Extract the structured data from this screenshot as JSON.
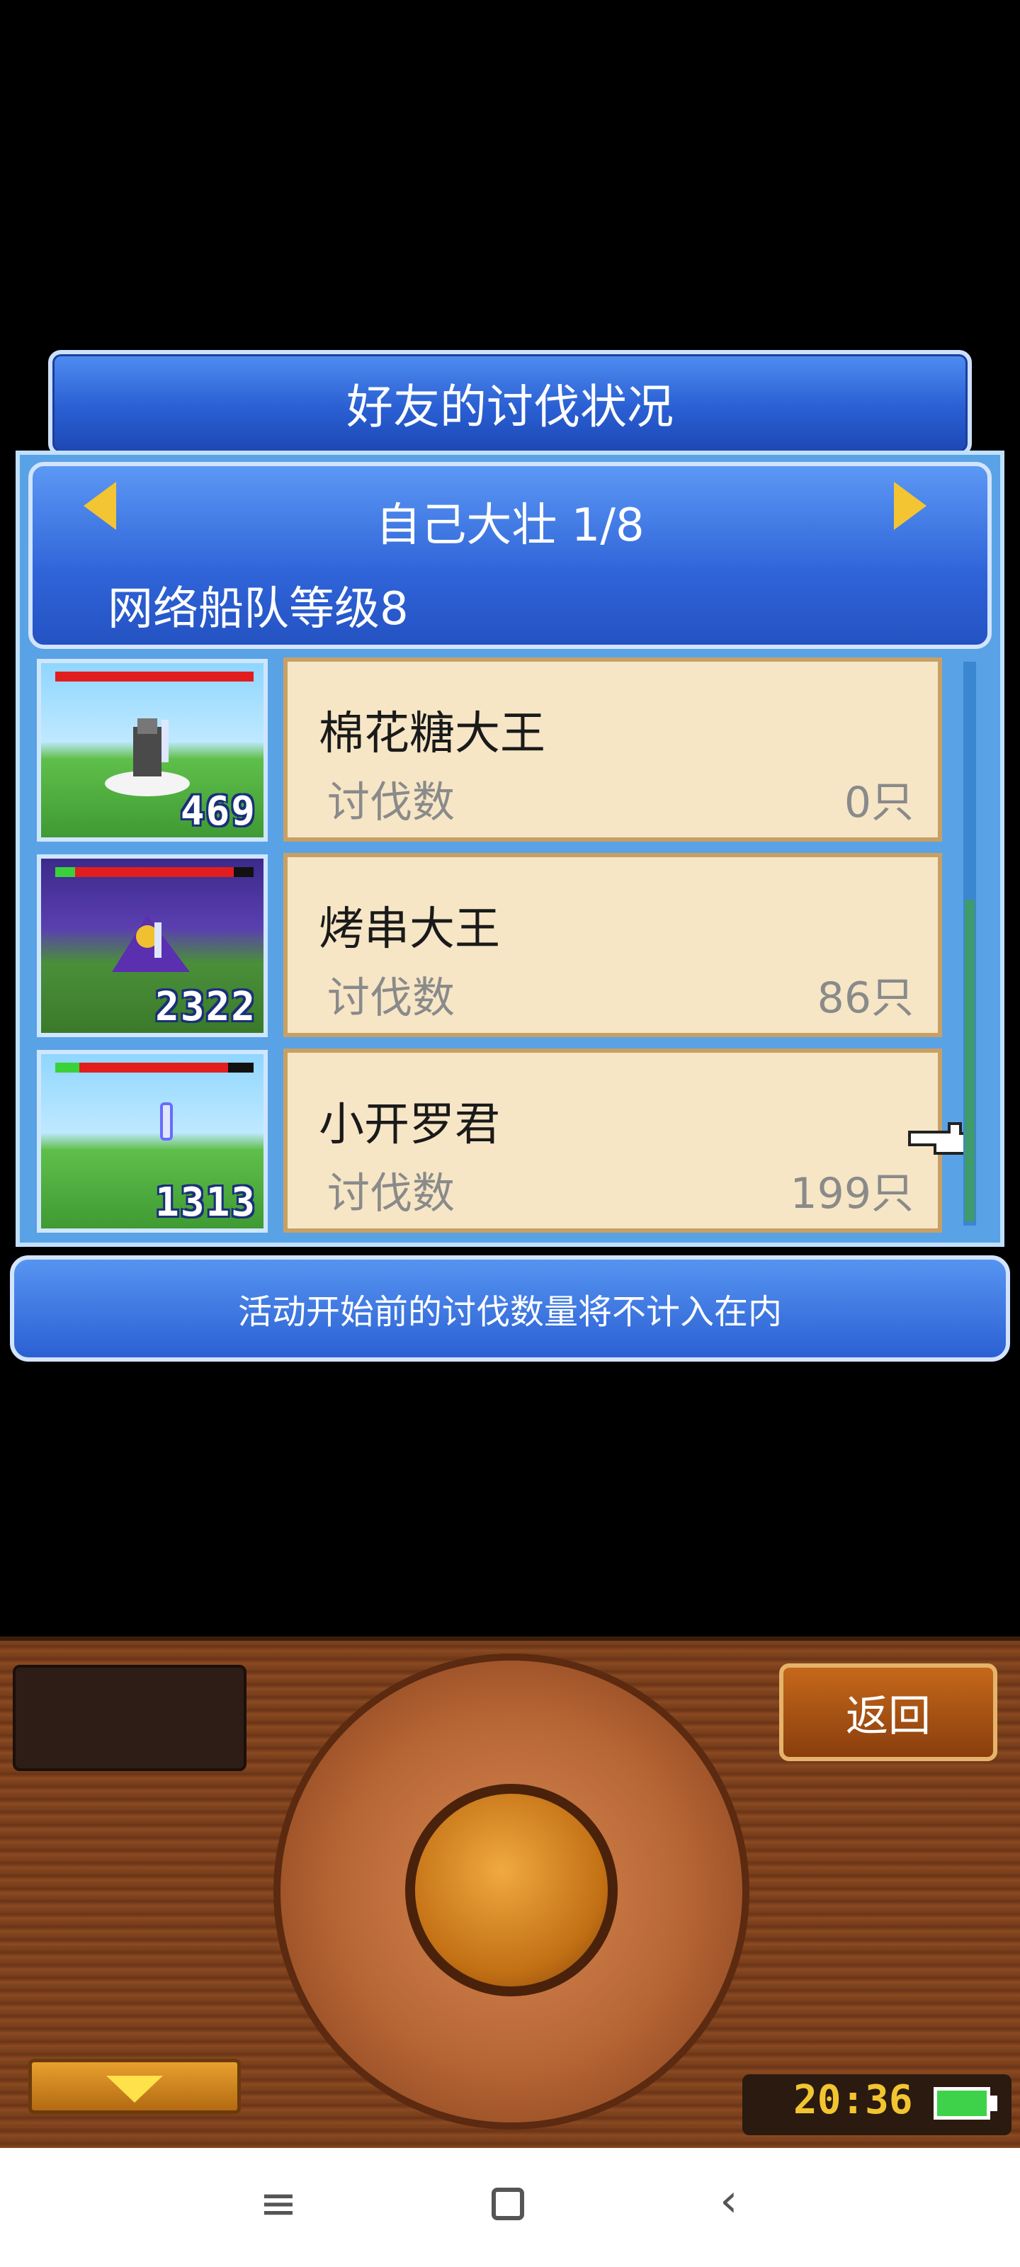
{
  "title": "好友的讨伐状况",
  "header": {
    "friend_name": "自己大壮 1/8",
    "fleet_level": "网络船队等级8"
  },
  "friends": [
    {
      "name": "棉花糖大王",
      "label": "讨伐数",
      "count": "0只",
      "level": "469",
      "hp_fraction": 1.0
    },
    {
      "name": "烤串大王",
      "label": "讨伐数",
      "count": "86只",
      "level": "2322",
      "hp_fraction": 0.9
    },
    {
      "name": "小开罗君",
      "label": "讨伐数",
      "count": "199只",
      "level": "1313",
      "hp_fraction": 0.75
    }
  ],
  "note": "活动开始前的讨伐数量将不计入在内",
  "controller": {
    "back_label": "返回",
    "clock": "20:36"
  },
  "icons": {
    "prev": "arrow-left-icon",
    "next": "arrow-right-icon",
    "pointer": "hand-pointer-icon"
  }
}
